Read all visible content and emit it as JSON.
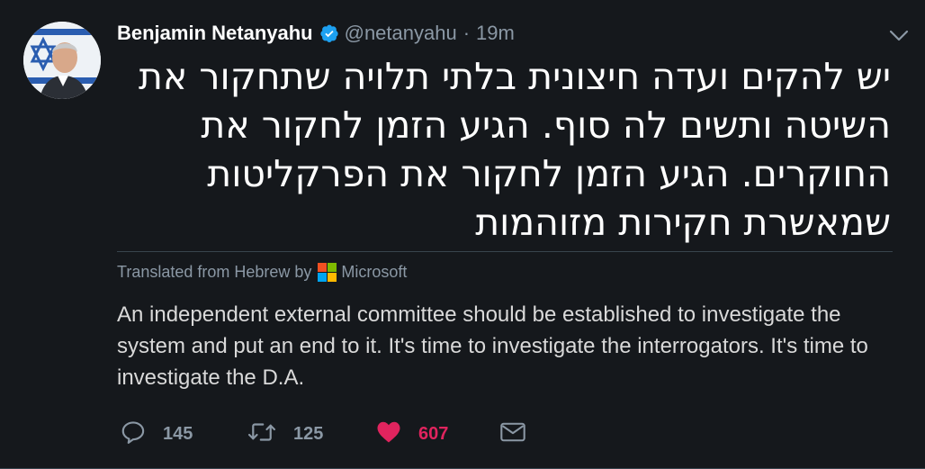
{
  "author": {
    "name": "Benjamin Netanyahu",
    "handle": "@netanyahu",
    "separator": "·",
    "time": "19m"
  },
  "tweet": {
    "text_he": "יש להקים ועדה חיצונית בלתי תלויה שתחקור את השיטה ותשים לה סוף. הגיע הזמן לחקור את החוקרים. הגיע הזמן לחקור את הפרקליטות שמאשרת חקירות מזוהמות",
    "translated_label": "Translated from Hebrew by",
    "translator": "Microsoft",
    "text_en": "An independent external committee should be established to investigate the system and put an end to it. It's time to investigate the interrogators. It's time to investigate the D.A."
  },
  "actions": {
    "replies": "145",
    "retweets": "125",
    "likes": "607"
  },
  "colors": {
    "background": "#15181c",
    "verified": "#1da1f2",
    "like": "#e0245e",
    "muted": "#8b98a5"
  },
  "icons": {
    "verified": "verified-badge-icon",
    "caret": "chevron-down-icon",
    "reply": "reply-icon",
    "retweet": "retweet-icon",
    "like": "heart-icon",
    "share": "envelope-icon"
  }
}
